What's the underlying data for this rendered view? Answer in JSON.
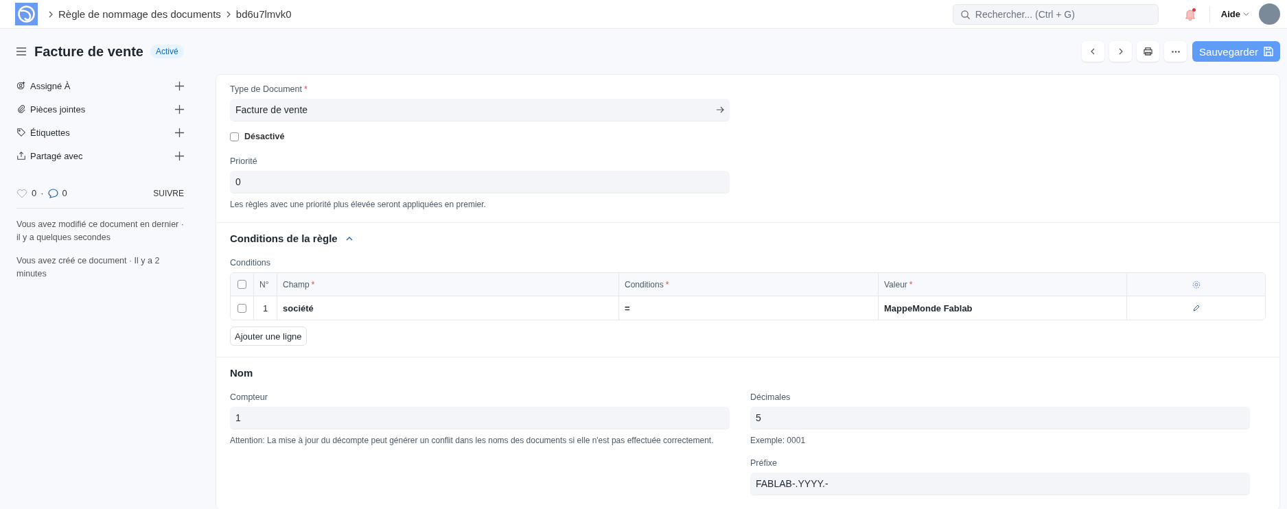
{
  "navbar": {
    "breadcrumbs": [
      "Règle de nommage des documents",
      "bd6u7lmvk0"
    ],
    "search": {
      "placeholder": "Rechercher... (Ctrl + G)"
    },
    "notifications_unread": true,
    "help": "Aide"
  },
  "header": {
    "title": "Facture de vente",
    "status": "Activé",
    "save": "Sauvegarder"
  },
  "sidebar": {
    "items": [
      {
        "kind": "assign",
        "label": "Assigné À"
      },
      {
        "kind": "attach",
        "label": "Pièces jointes"
      },
      {
        "kind": "tag",
        "label": "Étiquettes"
      },
      {
        "kind": "share",
        "label": "Partagé avec"
      }
    ],
    "likes": "0",
    "separator": "·",
    "comments": "0",
    "follow": "SUIVRE",
    "activity": [
      "Vous avez modifié ce document en dernier · il y a quelques secondes",
      "Vous avez créé ce document · Il y a 2 minutes"
    ]
  },
  "form": {
    "document_type": {
      "label": "Type de Document",
      "required_mark": "*",
      "value": "Facture de vente"
    },
    "disabled": {
      "label": "Désactivé",
      "checked": false
    },
    "priority": {
      "label": "Priorité",
      "value": "0",
      "description": "Les règles avec une priorité plus élevée seront appliquées en premier."
    },
    "conditions_section": {
      "title": "Conditions de la règle",
      "expanded": true,
      "table_label": "Conditions",
      "select_all": {
        "checked": false
      },
      "columns": [
        {
          "label": "N°"
        },
        {
          "label": "Champ",
          "required_mark": "*"
        },
        {
          "label": "Conditions",
          "required_mark": "*"
        },
        {
          "label": "Valeur",
          "required_mark": "*"
        }
      ],
      "rows": [
        {
          "selected": false,
          "cells": [
            "1",
            "société",
            "=",
            "MappeMonde Fablab"
          ]
        }
      ],
      "add_row": "Ajouter une ligne"
    },
    "naming_section": {
      "title": "Nom",
      "counter": {
        "label": "Compteur",
        "value": "1",
        "description": "Attention: La mise à jour du décompte peut générer un conflit dans les noms des documents si elle n'est pas effectuée correctement."
      },
      "digits": {
        "label": "Décimales",
        "value": "5",
        "description": "Exemple: 0001"
      },
      "prefix": {
        "label": "Préfixe",
        "value": "FABLAB-.YYYY.-"
      }
    }
  }
}
